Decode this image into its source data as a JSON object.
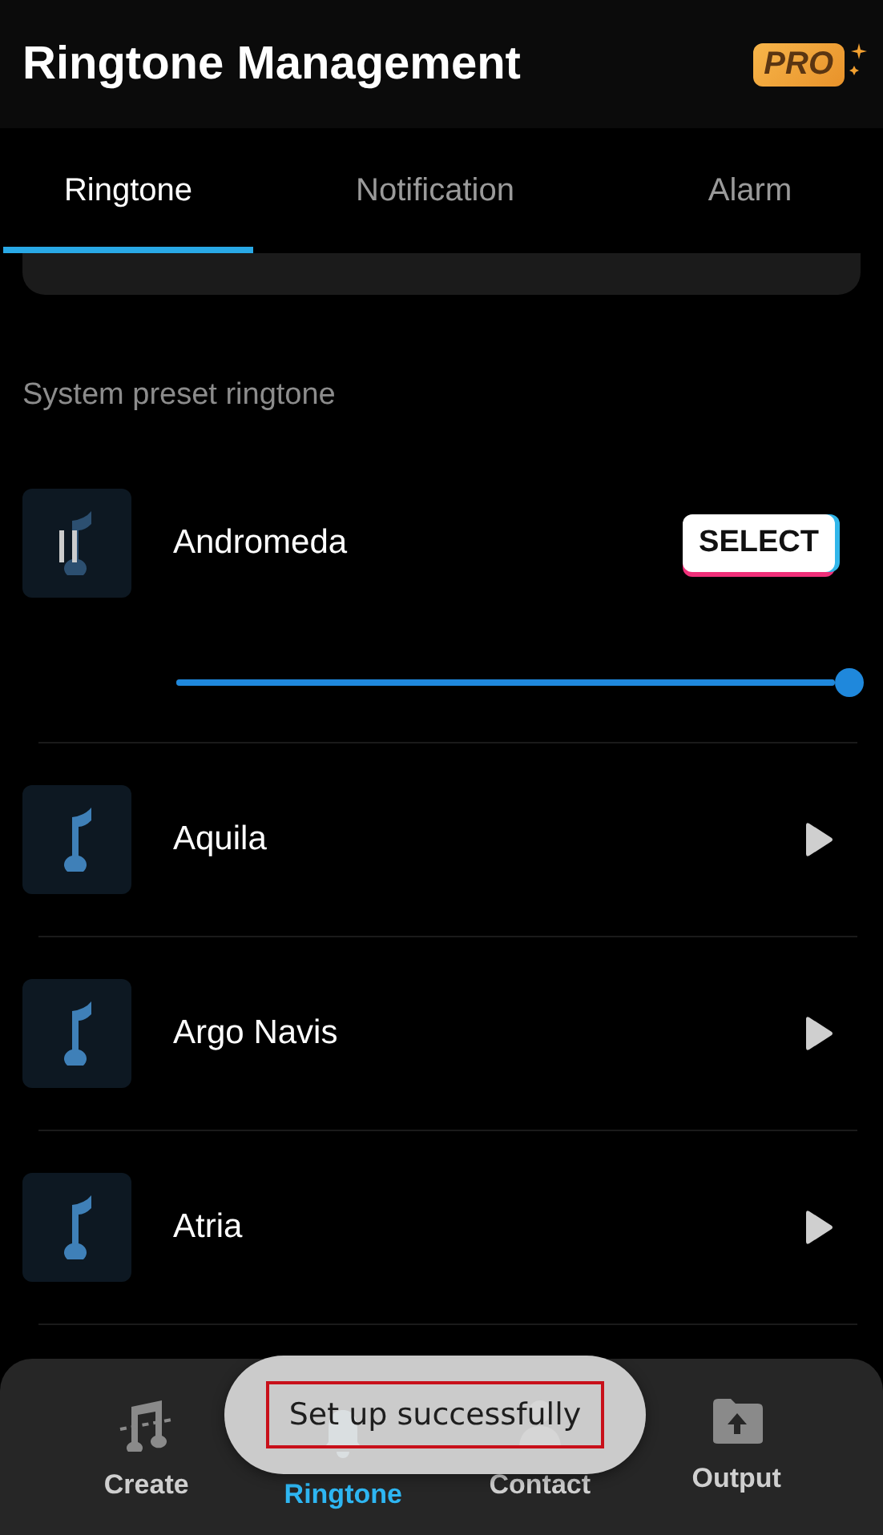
{
  "header": {
    "title": "Ringtone Management",
    "badge": "PRO"
  },
  "tabs": [
    {
      "label": "Ringtone",
      "selected": true
    },
    {
      "label": "Notification",
      "selected": false
    },
    {
      "label": "Alarm",
      "selected": false
    }
  ],
  "section_label": "System preset ringtone",
  "ringtones": [
    {
      "name": "Andromeda",
      "playing": true,
      "action": "SELECT",
      "level": 1
    },
    {
      "name": "Aquila",
      "playing": false
    },
    {
      "name": "Argo Navis",
      "playing": false
    },
    {
      "name": "Atria",
      "playing": false
    }
  ],
  "bottom_nav": [
    {
      "label": "Create",
      "kind": "create",
      "selected": false
    },
    {
      "label": "Ringtone",
      "kind": "ringtone",
      "selected": true
    },
    {
      "label": "Contact",
      "kind": "contact",
      "selected": false
    },
    {
      "label": "Output",
      "kind": "output",
      "selected": false
    }
  ],
  "toast": {
    "text": "Set up successfully",
    "highlighted": true
  }
}
